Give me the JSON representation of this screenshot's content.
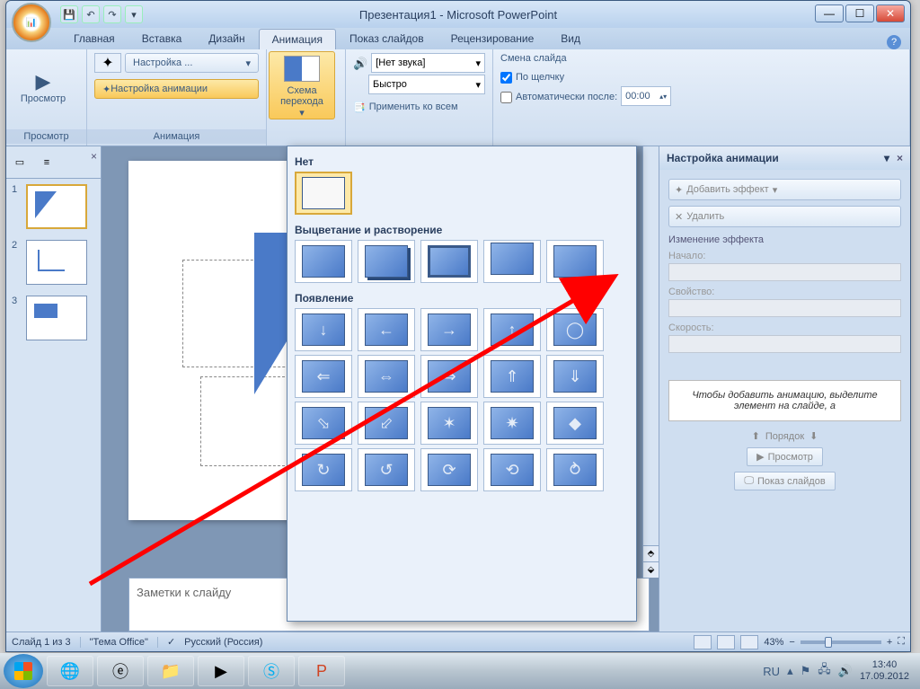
{
  "window": {
    "title": "Презентация1 - Microsoft PowerPoint"
  },
  "tabs": {
    "home": "Главная",
    "insert": "Вставка",
    "design": "Дизайн",
    "animation": "Анимация",
    "slideshow": "Показ слайдов",
    "review": "Рецензирование",
    "view": "Вид"
  },
  "ribbon": {
    "preview_group": "Просмотр",
    "preview_btn": "Просмотр",
    "anim_group": "Анимация",
    "custom_btn": "Настройка ...",
    "custom_anim_btn": "Настройка анимации",
    "schema_btn": "Схема перехода",
    "sound_label": "[Нет звука]",
    "speed_label": "Быстро",
    "apply_all": "Применить ко всем",
    "transition_heading": "Смена слайда",
    "on_click": "По щелчку",
    "auto_after": "Автоматически после:",
    "auto_time": "00:00"
  },
  "gallery": {
    "none_section": "Нет",
    "fade_section": "Выцветание и растворение",
    "appear_section": "Появление"
  },
  "anim_pane": {
    "title": "Настройка анимации",
    "add_effect": "Добавить эффект",
    "remove": "Удалить",
    "change_effect": "Изменение эффекта",
    "start": "Начало:",
    "property": "Свойство:",
    "speed": "Скорость:",
    "hint": "Чтобы добавить анимацию, выделите элемент на слайде, а",
    "order": "Порядок",
    "preview_btn": "Просмотр",
    "slideshow_btn": "Показ слайдов"
  },
  "thumbs": [
    "1",
    "2",
    "3"
  ],
  "notes": "Заметки к слайду",
  "status": {
    "slide": "Слайд 1 из 3",
    "theme": "\"Тема Office\"",
    "lang": "Русский (Россия)",
    "zoom": "43%"
  },
  "tray": {
    "lang": "RU",
    "time": "13:40",
    "date": "17.09.2012"
  }
}
